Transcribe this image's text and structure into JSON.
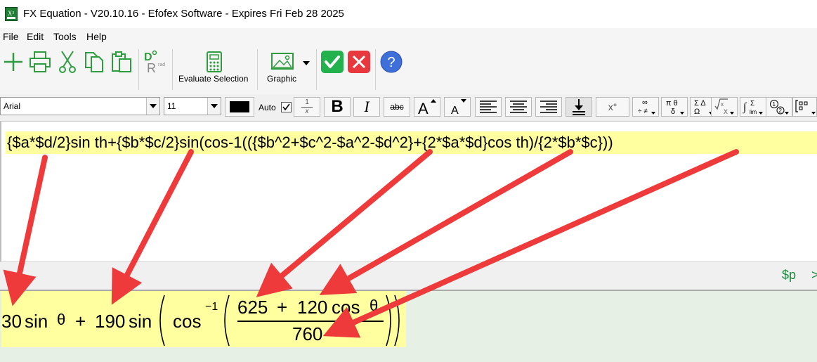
{
  "window": {
    "title": "FX Equation - V20.10.16 - Efofex Software - Expires Fri Feb 28 2025",
    "icon_name": "fx-equation-app-icon",
    "icon_text": "X²"
  },
  "menu": {
    "items": [
      "File",
      "Edit",
      "Tools",
      "Help"
    ]
  },
  "toolbar": {
    "buttons": [
      "new-icon",
      "print-icon",
      "cut-icon",
      "copy-icon",
      "paste-icon",
      "degrees-radians-icon",
      "calculator-icon",
      "graphic-icon",
      "ok-icon",
      "cancel-icon",
      "help-icon"
    ],
    "evaluate_label": "Evaluate Selection",
    "graphic_label": "Graphic",
    "help_glyph": "?",
    "colors": {
      "ok": "#22b14c",
      "cancel": "#e8383d",
      "help": "#3f6fd8",
      "green_icon": "#2e9c3f"
    }
  },
  "format_bar": {
    "font": "Arial",
    "size": "11",
    "auto_label": "Auto",
    "auto_checked": true,
    "buttons": {
      "fraction_top": "1",
      "fraction_bottom": "x",
      "bold": "B",
      "italic": "I",
      "strike": "abc",
      "degree": "x°",
      "pi_theta": "π θ",
      "delta": "δ",
      "sigma": "Σ Δ",
      "omega": "Ω",
      "infinity": "∞"
    }
  },
  "editor": {
    "text": "{$a*$d/2}sin th+{$b*$c/2}sin(cos-1(({$b^2+$c^2-$a^2-$d^2}+{2*$a*$d}cos th)/{2*$b*$c}))"
  },
  "status": {
    "var_label": "$p",
    "more_label": ">"
  },
  "preview": {
    "term1_coef": "30",
    "sin1": "sin",
    "theta1": "θ",
    "plus1": "+",
    "term2_coef": "190",
    "sin2": "sin",
    "cos": "cos",
    "inverse": "−1",
    "numerator_const": "625",
    "plus2": "+",
    "numerator_coef": "120",
    "cos2": "cos",
    "theta2": "θ",
    "denominator": "760"
  },
  "annotations": {
    "arrow_color": "#ee3a3a"
  }
}
